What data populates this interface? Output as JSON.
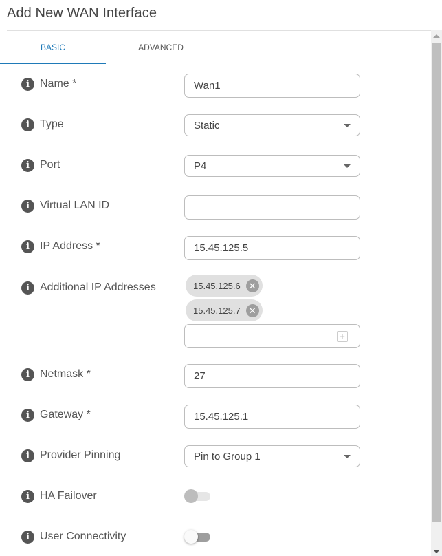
{
  "header": {
    "title": "Add New WAN Interface"
  },
  "tabs": [
    {
      "label": "BASIC",
      "active": true
    },
    {
      "label": "ADVANCED",
      "active": false
    }
  ],
  "form": {
    "name": {
      "label": "Name *",
      "value": "Wan1"
    },
    "type": {
      "label": "Type",
      "value": "Static"
    },
    "port": {
      "label": "Port",
      "value": "P4"
    },
    "vlan": {
      "label": "Virtual LAN ID",
      "value": ""
    },
    "ip_address": {
      "label": "IP Address *",
      "value": "15.45.125.5"
    },
    "additional_ips": {
      "label": "Additional IP Addresses",
      "chips": [
        "15.45.125.6",
        "15.45.125.7"
      ],
      "input_value": "",
      "remove_glyph": "✕",
      "add_glyph": "+"
    },
    "netmask": {
      "label": "Netmask *",
      "value": "27"
    },
    "gateway": {
      "label": "Gateway *",
      "value": "15.45.125.1"
    },
    "provider_pinning": {
      "label": "Provider Pinning",
      "value": "Pin to Group 1"
    },
    "ha_failover": {
      "label": "HA Failover",
      "enabled": false,
      "disabled": true
    },
    "user_connectivity": {
      "label": "User Connectivity",
      "enabled": false,
      "disabled": false
    }
  },
  "icons": {
    "info": "i"
  },
  "colors": {
    "accent": "#1f7ab8",
    "info_icon": "#555555"
  }
}
